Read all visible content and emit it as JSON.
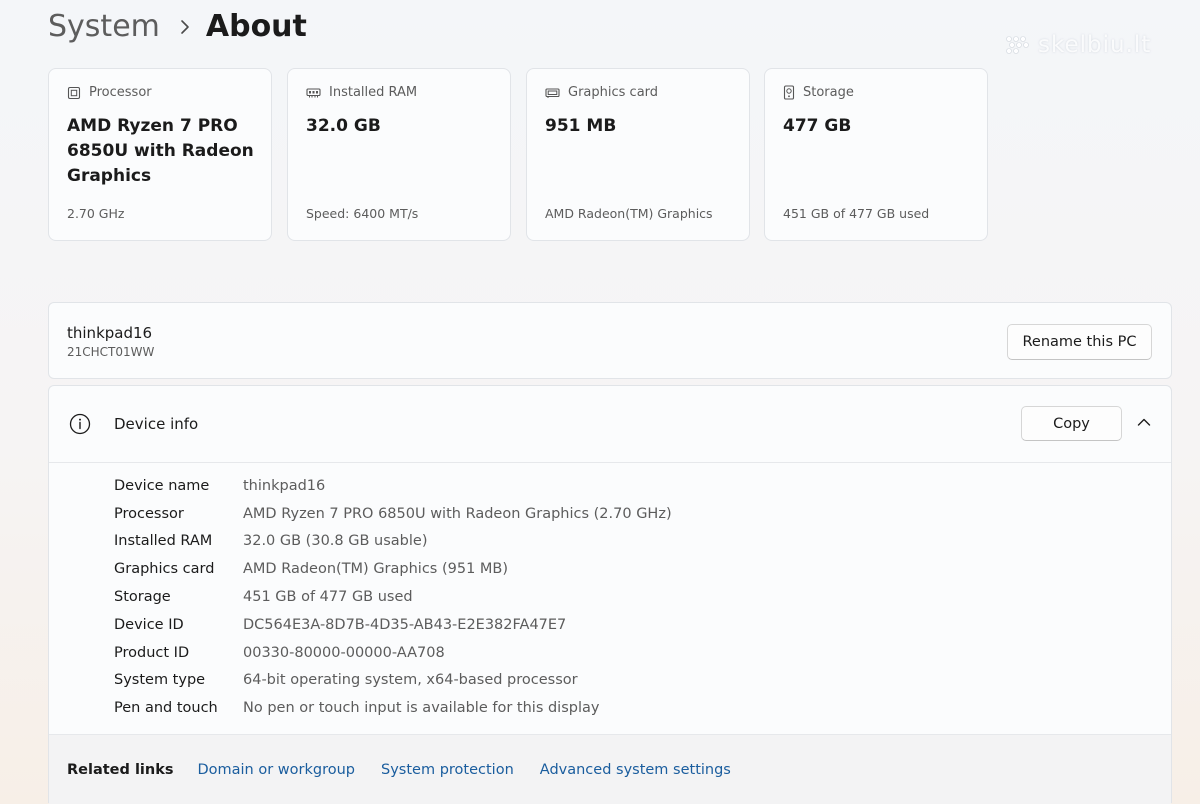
{
  "breadcrumb": {
    "parent": "System",
    "current": "About"
  },
  "watermark": {
    "text": "skelbiu.lt"
  },
  "spec_cards": [
    {
      "icon": "processor-icon",
      "title": "Processor",
      "value": "AMD Ryzen 7 PRO 6850U with Radeon Graphics",
      "sub": "2.70 GHz"
    },
    {
      "icon": "ram-icon",
      "title": "Installed RAM",
      "value": "32.0 GB",
      "sub": "Speed: 6400 MT/s"
    },
    {
      "icon": "graphics-card-icon",
      "title": "Graphics card",
      "value": "951 MB",
      "sub": "AMD Radeon(TM) Graphics"
    },
    {
      "icon": "storage-icon",
      "title": "Storage",
      "value": "477 GB",
      "sub": "451 GB of 477 GB used"
    }
  ],
  "pc": {
    "name": "thinkpad16",
    "model": "21CHCT01WW",
    "rename_label": "Rename this PC"
  },
  "device_info": {
    "title": "Device info",
    "copy_label": "Copy",
    "rows": [
      {
        "label": "Device name",
        "value": "thinkpad16"
      },
      {
        "label": "Processor",
        "value": "AMD Ryzen 7 PRO 6850U with Radeon Graphics (2.70 GHz)"
      },
      {
        "label": "Installed RAM",
        "value": "32.0 GB (30.8 GB usable)"
      },
      {
        "label": "Graphics card",
        "value": "AMD Radeon(TM) Graphics (951 MB)"
      },
      {
        "label": "Storage",
        "value": "451 GB of 477 GB used"
      },
      {
        "label": "Device ID",
        "value": "DC564E3A-8D7B-4D35-AB43-E2E382FA47E7"
      },
      {
        "label": "Product ID",
        "value": "00330-80000-00000-AA708"
      },
      {
        "label": "System type",
        "value": "64-bit operating system, x64-based processor"
      },
      {
        "label": "Pen and touch",
        "value": "No pen or touch input is available for this display"
      }
    ]
  },
  "related": {
    "label": "Related links",
    "links": [
      "Domain or workgroup",
      "System protection",
      "Advanced system settings"
    ]
  },
  "colors": {
    "link": "#1a5d9e",
    "card_bg": "#fbfcfd",
    "border": "#e1e4e8"
  }
}
